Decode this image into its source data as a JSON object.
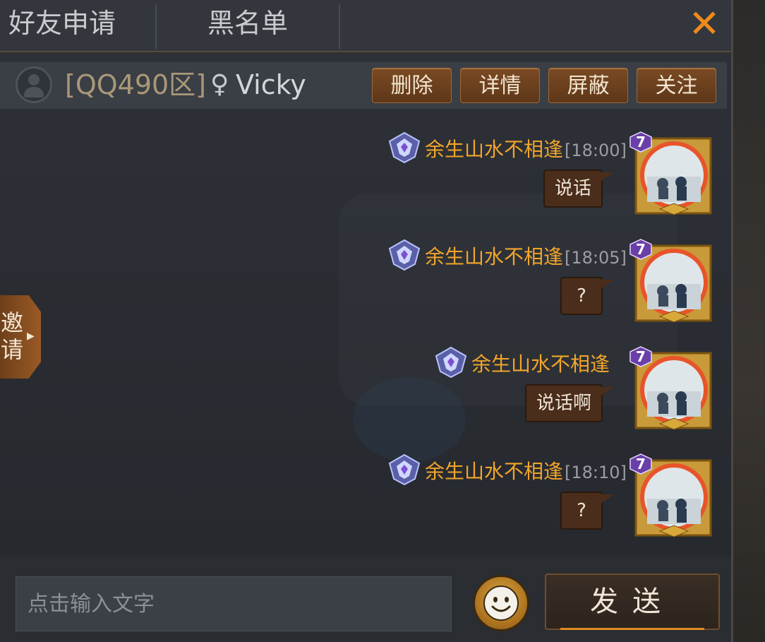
{
  "tabs": {
    "friend_requests": "好友申请",
    "blacklist": "黑名单"
  },
  "close_label": "✕",
  "friend": {
    "server": "[QQ490区]",
    "gender_symbol": "♀",
    "name": "Vicky"
  },
  "actions": {
    "delete": "删除",
    "details": "详情",
    "block": "屏蔽",
    "follow": "关注"
  },
  "invite_label": "邀请",
  "messages": [
    {
      "sender": "余生山水不相逢",
      "time": "[18:00]",
      "text": "说话",
      "level": "7"
    },
    {
      "sender": "余生山水不相逢",
      "time": "[18:05]",
      "text": "?",
      "level": "7"
    },
    {
      "sender": "余生山水不相逢",
      "time": "",
      "text": "说话啊",
      "level": "7"
    },
    {
      "sender": "余生山水不相逢",
      "time": "[18:10]",
      "text": "?",
      "level": "7"
    }
  ],
  "input": {
    "placeholder": "点击输入文字"
  },
  "send_label": "发送",
  "colors": {
    "accent_orange": "#f08a1a",
    "sender_name": "#f2a52a",
    "button_brown": "#6b4020"
  },
  "icons": {
    "close": "close-icon",
    "avatar": "user-silhouette-icon",
    "rank": "diamond-rank-badge-icon",
    "emoji": "smiley-face-icon"
  }
}
